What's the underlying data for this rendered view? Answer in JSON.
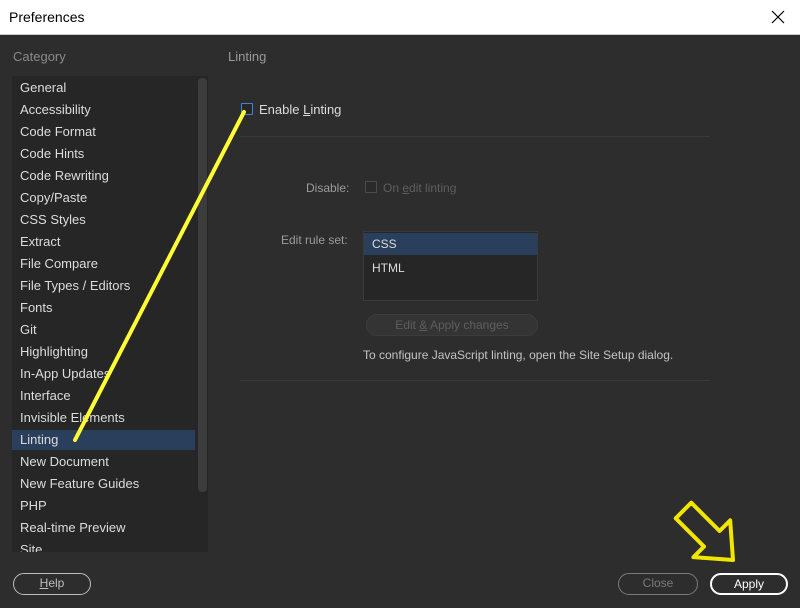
{
  "window": {
    "title": "Preferences"
  },
  "category": {
    "label": "Category",
    "items": [
      {
        "label": "General"
      },
      {
        "label": "Accessibility"
      },
      {
        "label": "Code Format"
      },
      {
        "label": "Code Hints"
      },
      {
        "label": "Code Rewriting"
      },
      {
        "label": "Copy/Paste"
      },
      {
        "label": "CSS Styles"
      },
      {
        "label": "Extract"
      },
      {
        "label": "File Compare"
      },
      {
        "label": "File Types / Editors"
      },
      {
        "label": "Fonts"
      },
      {
        "label": "Git"
      },
      {
        "label": "Highlighting"
      },
      {
        "label": "In-App Updates"
      },
      {
        "label": "Interface"
      },
      {
        "label": "Invisible Elements"
      },
      {
        "label": "Linting",
        "selected": true
      },
      {
        "label": "New Document"
      },
      {
        "label": "New Feature Guides"
      },
      {
        "label": "PHP"
      },
      {
        "label": "Real-time Preview"
      },
      {
        "label": "Site"
      }
    ]
  },
  "panel": {
    "title": "Linting",
    "enable_linting": {
      "pre": "Enable ",
      "key": "L",
      "post": "inting",
      "checked": false
    },
    "disable": {
      "label": "Disable:",
      "option_pre": "On ",
      "option_key": "e",
      "option_post": "dit linting",
      "checked": false,
      "enabled": false
    },
    "rule_set": {
      "label": "Edit rule set:",
      "items": [
        {
          "label": "CSS",
          "selected": true
        },
        {
          "label": "HTML"
        }
      ]
    },
    "edit_button": {
      "pre": "Edit ",
      "key": "&",
      "post": " Apply changes",
      "enabled": false
    },
    "info_text": "To configure JavaScript linting, open the Site Setup dialog."
  },
  "footer": {
    "help": {
      "key": "H",
      "post": "elp"
    },
    "close": {
      "label": "Close",
      "enabled": false
    },
    "apply": {
      "label": "Apply"
    }
  },
  "annotations": {
    "color": "#ffff33",
    "apply_arrow_color": "#f2e600"
  },
  "colors": {
    "selection": "#2a3f5b",
    "checkbox_focus": "#3e86d6",
    "background": "#2d2d2d"
  }
}
